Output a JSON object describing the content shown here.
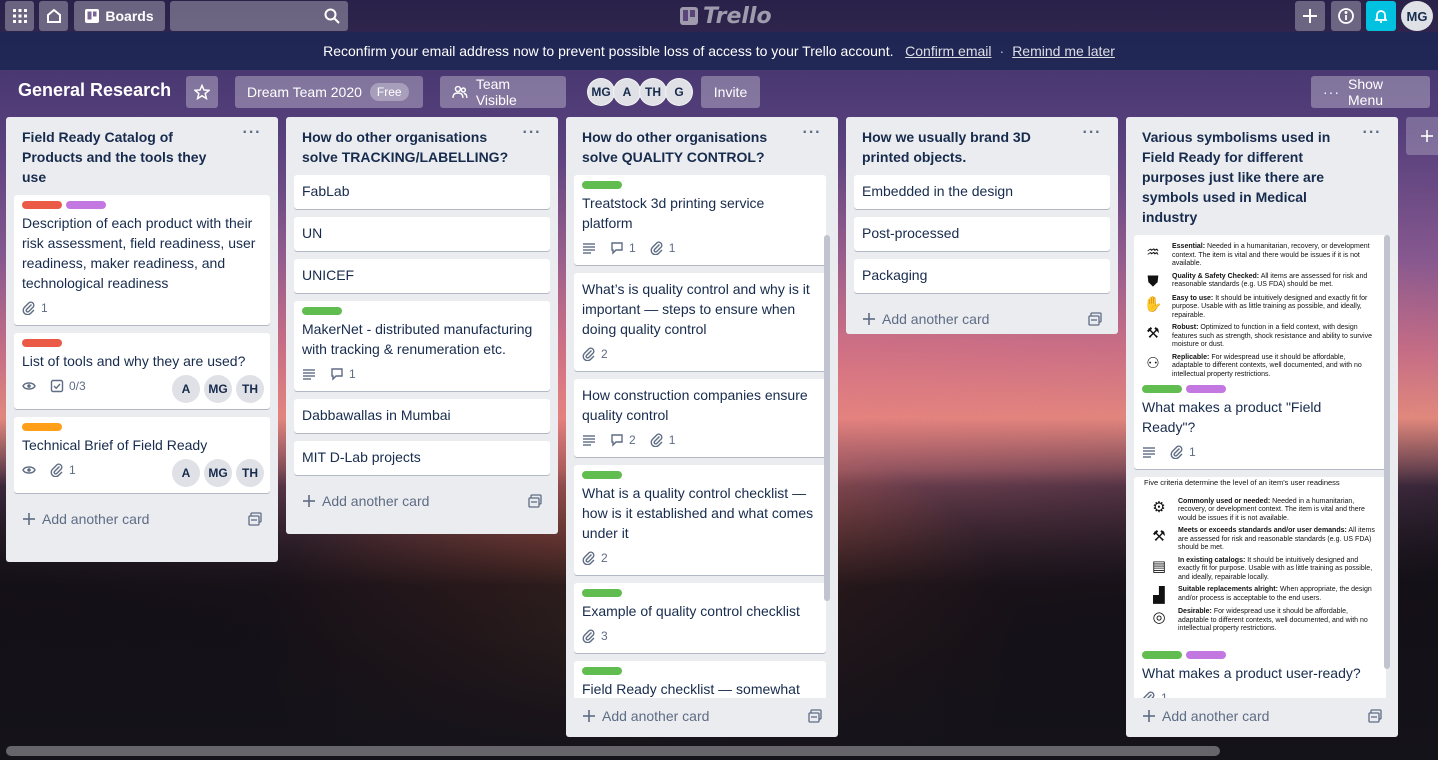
{
  "topbar": {
    "boards_label": "Boards",
    "logo_text": "Trello",
    "avatar": "MG"
  },
  "banner": {
    "message": "Reconfirm your email address now to prevent possible loss of access to your Trello account.",
    "confirm": "Confirm email",
    "separator": "·",
    "remind": "Remind me later"
  },
  "board": {
    "title": "General Research",
    "team": "Dream Team 2020",
    "team_badge": "Free",
    "visibility": "Team Visible",
    "members": [
      "MG",
      "A",
      "TH",
      "G"
    ],
    "invite": "Invite",
    "show_menu": "Show Menu"
  },
  "add_card_label": "Add another card",
  "lists": [
    {
      "title": "Field Ready Catalog of Products and the tools they use",
      "cards": [
        {
          "title": "Description of each product with their risk assessment, field readiness, user readiness, maker readiness, and technological readiness",
          "attachments": "1"
        },
        {
          "title": "List of tools and why they are used?",
          "checklist": "0/3",
          "members": [
            "A",
            "MG",
            "TH"
          ]
        },
        {
          "title": "Technical Brief of Field Ready",
          "attachments": "1",
          "members": [
            "A",
            "MG",
            "TH"
          ]
        }
      ]
    },
    {
      "title": "How do other organisations solve TRACKING/LABELLING?",
      "cards": [
        {
          "title": "FabLab"
        },
        {
          "title": "UN"
        },
        {
          "title": "UNICEF"
        },
        {
          "title": "MakerNet - distributed manufacturing with tracking & renumeration etc.",
          "comments": "1"
        },
        {
          "title": "Dabbawallas in Mumbai"
        },
        {
          "title": "MIT D-Lab projects"
        }
      ]
    },
    {
      "title": "How do other organisations solve QUALITY CONTROL?",
      "cards": [
        {
          "title": "Treatstock 3d printing service platform",
          "comments": "1",
          "attachments": "1"
        },
        {
          "title": "What’s is quality control and why is it important — steps to ensure when doing quality control",
          "attachments": "2"
        },
        {
          "title": "How construction companies ensure quality control",
          "comments": "2",
          "attachments": "1"
        },
        {
          "title": "What is a quality control checklist — how is it established and what comes under it",
          "attachments": "2"
        },
        {
          "title": "Example of quality control checklist",
          "attachments": "3"
        },
        {
          "title": "Field Ready checklist — somewhat"
        }
      ]
    },
    {
      "title": "How we usually brand 3D printed objects.",
      "cards": [
        {
          "title": "Embedded in the design"
        },
        {
          "title": "Post-processed"
        },
        {
          "title": "Packaging"
        }
      ]
    },
    {
      "title": "Various symbolisms used in Field Ready for different purposes just like there are symbols used in Medical industry",
      "cards": [
        {
          "title": "What makes a product \"Field Ready\"?",
          "attachments": "1",
          "image": [
            {
              "term": "Essential:",
              "desc": "Needed in a humanitarian, recovery, or development context. The item is vital and there would be issues if it is not available."
            },
            {
              "term": "Quality & Safety Checked:",
              "desc": "All items are assessed for risk and reasonable standards (e.g. US FDA) should be met."
            },
            {
              "term": "Easy to use:",
              "desc": "It should be intuitively designed and exactly fit for purpose. Usable with as little training as possible, and ideally, repairable."
            },
            {
              "term": "Robust:",
              "desc": "Optimized to function in a field context, with design features such as strength, shock resistance and ability to survive moisture or dust."
            },
            {
              "term": "Replicable:",
              "desc": "For widespread use it should be affordable, adaptable to different contexts, well documented, and with no intellectual property restrictions."
            }
          ]
        },
        {
          "title": "What makes a product user-ready?",
          "attachments": "1",
          "image_caption": "Five criteria determine the level of an item's user readiness",
          "image": [
            {
              "term": "Commonly used or needed:",
              "desc": "Needed in a humanitarian, recovery, or development context. The item is vital and there would be issues if it is not available."
            },
            {
              "term": "Meets or exceeds standards and/or user demands:",
              "desc": "All items are assessed for risk and reasonable standards (e.g. US FDA) should be met."
            },
            {
              "term": "In existing catalogs:",
              "desc": "It should be intuitively designed and exactly fit for purpose. Usable with as little training as possible, and ideally, repairable locally."
            },
            {
              "term": "Suitable replacements alright:",
              "desc": "When appropriate, the design and/or process is acceptable to the end users."
            },
            {
              "term": "Desirable:",
              "desc": "For widespread use it should be affordable, adaptable to different contexts, well documented, and with no intellectual property restrictions."
            }
          ]
        }
      ]
    }
  ]
}
